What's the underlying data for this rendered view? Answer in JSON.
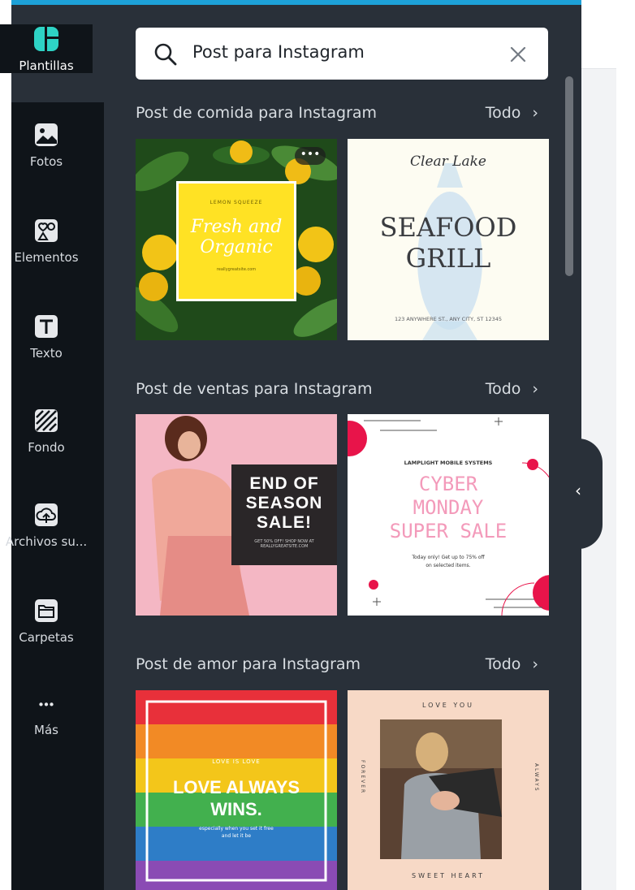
{
  "rail": {
    "items": [
      {
        "label": "Plantillas",
        "icon": "templates-icon"
      },
      {
        "label": "Fotos",
        "icon": "photo-icon"
      },
      {
        "label": "Elementos",
        "icon": "elements-icon"
      },
      {
        "label": "Texto",
        "icon": "text-icon"
      },
      {
        "label": "Fondo",
        "icon": "background-icon"
      },
      {
        "label": "Archivos su...",
        "icon": "upload-cloud-icon"
      },
      {
        "label": "Carpetas",
        "icon": "folder-icon"
      },
      {
        "label": "Más",
        "icon": "more-icon"
      }
    ]
  },
  "search": {
    "value": "Post para Instagram"
  },
  "sections": [
    {
      "title": "Post de comida para Instagram",
      "all": "Todo",
      "cards": [
        {
          "small": "LEMON SQUEEZE",
          "main1": "Fresh and",
          "main2": "Organic",
          "footer": "reallygreatsite.com"
        },
        {
          "script": "Clear Lake",
          "main1": "SEAFOOD",
          "main2": "GRILL",
          "footer": "123 ANYWHERE ST., ANY CITY, ST 12345"
        }
      ]
    },
    {
      "title": "Post de ventas para Instagram",
      "all": "Todo",
      "cards": [
        {
          "main1": "END OF",
          "main2": "SEASON",
          "main3": "SALE!",
          "footer": "GET 50% OFF! SHOP NOW AT REALLYGREATSITE.COM"
        },
        {
          "small": "LAMPLIGHT MOBILE SYSTEMS",
          "main1": "CYBER",
          "main2": "MONDAY",
          "main3": "SUPER SALE",
          "footer1": "Today only! Get up to 75% off",
          "footer2": "on selected items."
        }
      ]
    },
    {
      "title": "Post de amor para Instagram",
      "all": "Todo",
      "cards": [
        {
          "small": "LOVE IS LOVE",
          "main1": "LOVE ALWAYS",
          "main2": "WINS.",
          "footer1": "especially when you set it free",
          "footer2": "and let it be"
        },
        {
          "top": "LOVE YOU",
          "left": "FOREVER",
          "right": "ALWAYS",
          "bottom": "SWEET HEART"
        }
      ]
    }
  ],
  "colors": {
    "rail_bg": "#0f1419",
    "panel_bg": "#293039",
    "accent": "#1da1d8",
    "brand_teal": "#2ed3c5"
  }
}
